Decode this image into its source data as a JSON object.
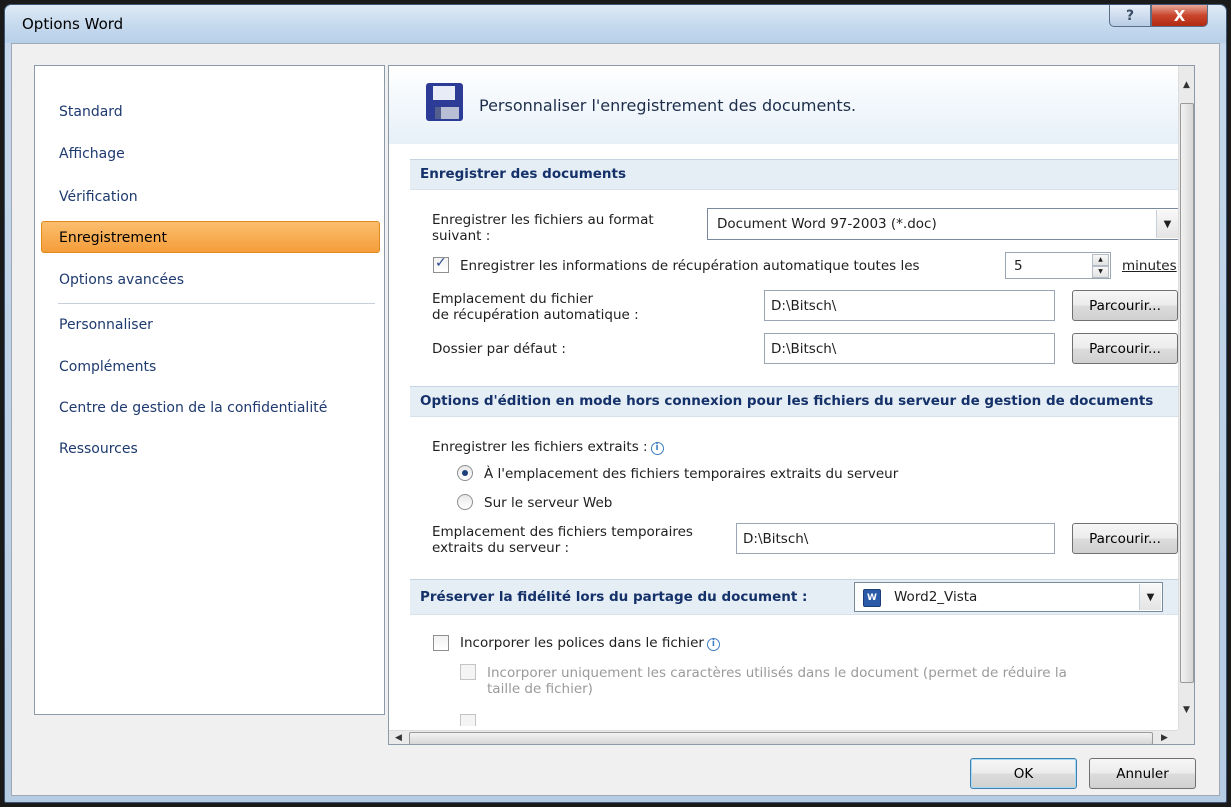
{
  "window": {
    "title": "Options Word",
    "help_glyph": "?",
    "close_glyph": "X"
  },
  "sidebar": {
    "items": [
      {
        "label": "Standard"
      },
      {
        "label": "Affichage"
      },
      {
        "label": "Vérification"
      },
      {
        "label": "Enregistrement",
        "active": true
      },
      {
        "label": "Options avancées"
      },
      {
        "label": "Personnaliser"
      },
      {
        "label": "Compléments"
      },
      {
        "label": "Centre de gestion de la confidentialité"
      },
      {
        "label": "Ressources"
      }
    ]
  },
  "header": {
    "title": "Personnaliser l'enregistrement des documents."
  },
  "save_docs": {
    "heading": "Enregistrer des documents",
    "format_label_1": "Enregistrer les fichiers au format",
    "format_label_2": "suivant :",
    "format_value": "Document Word 97-2003 (*.doc)",
    "autorecover_checked": true,
    "autorecover_label": "Enregistrer les informations de récupération automatique toutes les",
    "autorecover_minutes": "5",
    "minutes_label": "minutes",
    "autorecover_loc_label_1": "Emplacement du fichier",
    "autorecover_loc_label_2": "de récupération automatique :",
    "autorecover_loc_value": "D:\\Bitsch\\",
    "default_folder_label": "Dossier par défaut :",
    "default_folder_value": "D:\\Bitsch\\",
    "browse_label": "Parcourir..."
  },
  "offline": {
    "heading": "Options d'édition en mode hors connexion pour les fichiers du serveur de gestion de documents",
    "save_checked_out_label": "Enregistrer les fichiers extraits :",
    "radio_1": "À l'emplacement des fichiers temporaires extraits du serveur",
    "radio_2": "Sur le serveur Web",
    "selected_radio": 1,
    "temp_loc_label_1": "Emplacement des fichiers temporaires",
    "temp_loc_label_2": "extraits du serveur :",
    "temp_loc_value": "D:\\Bitsch\\",
    "browse_label": "Parcourir..."
  },
  "fidelity": {
    "heading": "Préserver la fidélité lors du partage du document :",
    "document": "Word2_Vista",
    "embed_fonts_label": "Incorporer les polices dans le fichier",
    "embed_fonts_checked": false,
    "embed_used_label_1": "Incorporer uniquement les caractères utilisés dans le document (permet de réduire la",
    "embed_used_label_2": "taille de fichier)"
  },
  "footer": {
    "ok_label": "OK",
    "cancel_label": "Annuler"
  },
  "icons": [
    "help-icon",
    "close-icon",
    "floppy-disk-icon",
    "info-icon",
    "word-document-icon",
    "dropdown-arrow-icon",
    "spin-up-icon",
    "spin-down-icon"
  ],
  "colors": {
    "active_nav": "#f59d3a",
    "section_bg": "#e5edf5",
    "section_text": "#15316a"
  }
}
